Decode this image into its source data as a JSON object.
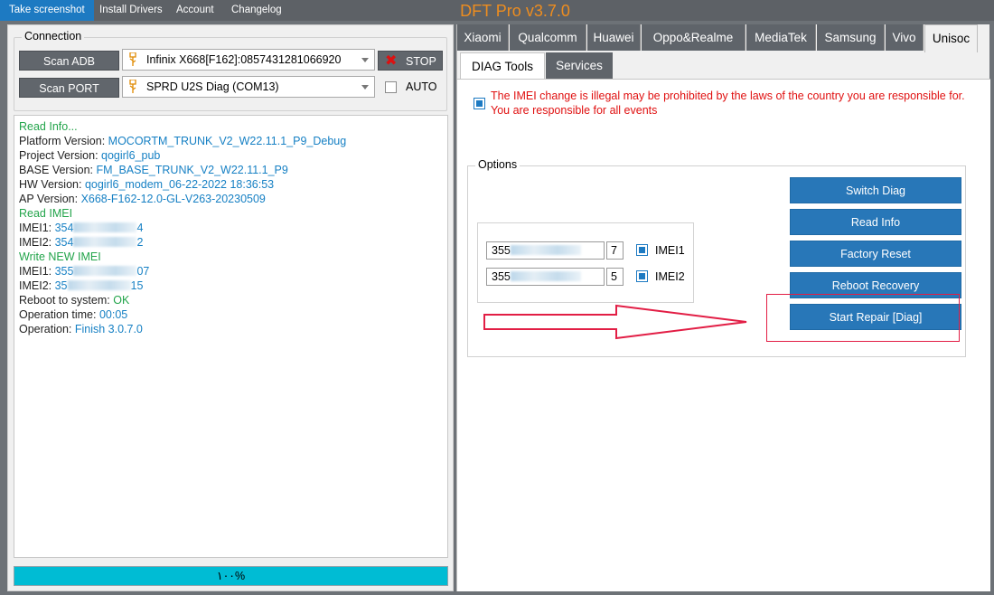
{
  "menu": {
    "items": [
      "Take screenshot",
      "Install Drivers",
      "Account",
      "Changelog"
    ],
    "active": "Take screenshot"
  },
  "app_title": "DFT Pro v3.7.0",
  "connection": {
    "legend": "Connection",
    "scan_adb_label": "Scan ADB",
    "scan_port_label": "Scan PORT",
    "adb_device": "Infinix X668[F162]:0857431281066920",
    "port_device": "SPRD U2S Diag (COM13)",
    "stop_label": "STOP",
    "auto_label": "AUTO"
  },
  "log": [
    {
      "label": "Read Info...",
      "label_color": "green",
      "value": ""
    },
    {
      "label": "Platform Version: ",
      "label_color": "dark",
      "value": "MOCORTM_TRUNK_V2_W22.11.1_P9_Debug"
    },
    {
      "label": "Project Version: ",
      "label_color": "dark",
      "value": "qogirl6_pub"
    },
    {
      "label": "BASE Version: ",
      "label_color": "dark",
      "value": "FM_BASE_TRUNK_V2_W22.11.1_P9"
    },
    {
      "label": "HW Version: ",
      "label_color": "dark",
      "value": "qogirl6_modem_06-22-2022 18:36:53"
    },
    {
      "label": "AP Version: ",
      "label_color": "dark",
      "value": "X668-F162-12.0-GL-V263-20230509"
    },
    {
      "label": "Read IMEI",
      "label_color": "green",
      "value": ""
    },
    {
      "label": "IMEI1: ",
      "label_color": "dark",
      "value_start": "354",
      "value_end": "4"
    },
    {
      "label": "IMEI2: ",
      "label_color": "dark",
      "value_start": "354",
      "value_end": "2"
    },
    {
      "label": "Write NEW IMEI",
      "label_color": "green",
      "value": ""
    },
    {
      "label": "IMEI1: ",
      "label_color": "dark",
      "value_start": "355",
      "value_end": "07"
    },
    {
      "label": "IMEI2: ",
      "label_color": "dark",
      "value_start": "35",
      "value_end": "15"
    },
    {
      "label": "Reboot to system: ",
      "label_color": "dark",
      "value": "OK",
      "value_color": "green"
    },
    {
      "label": "Operation time: ",
      "label_color": "dark",
      "value": "00:05"
    },
    {
      "label": "Operation: ",
      "label_color": "dark",
      "value": "Finish 3.0.7.0"
    }
  ],
  "progress": {
    "text": "١٠٠%",
    "percent": 100
  },
  "brand_tabs": [
    "Xiaomi",
    "Qualcomm",
    "Huawei",
    "Oppo&Realme",
    "MediaTek",
    "Samsung",
    "Vivo",
    "Unisoc"
  ],
  "brand_active": "Unisoc",
  "sub_tabs": [
    "DIAG Tools",
    "Services"
  ],
  "sub_active": "DIAG Tools",
  "warning": {
    "checked": true,
    "text": "The IMEI change is illegal may be prohibited by the laws of the country you are responsible for. You are responsible for all events"
  },
  "options": {
    "legend": "Options",
    "imei1": {
      "value": "355",
      "check_digit": "7",
      "label": "IMEI1",
      "checked": true
    },
    "imei2": {
      "value": "355",
      "check_digit": "5",
      "label": "IMEI2",
      "checked": true
    },
    "buttons": [
      "Switch Diag",
      "Read Info",
      "Factory Reset",
      "Reboot Recovery",
      "Start Repair [Diag]"
    ]
  },
  "colors": {
    "accent": "#1d7ac2",
    "title": "#ee8d1f",
    "log_green": "#22a44a",
    "log_blue": "#1680c4",
    "warning_red": "#e01010",
    "highlight_red": "#e21e45",
    "progress": "#00bcd4"
  }
}
